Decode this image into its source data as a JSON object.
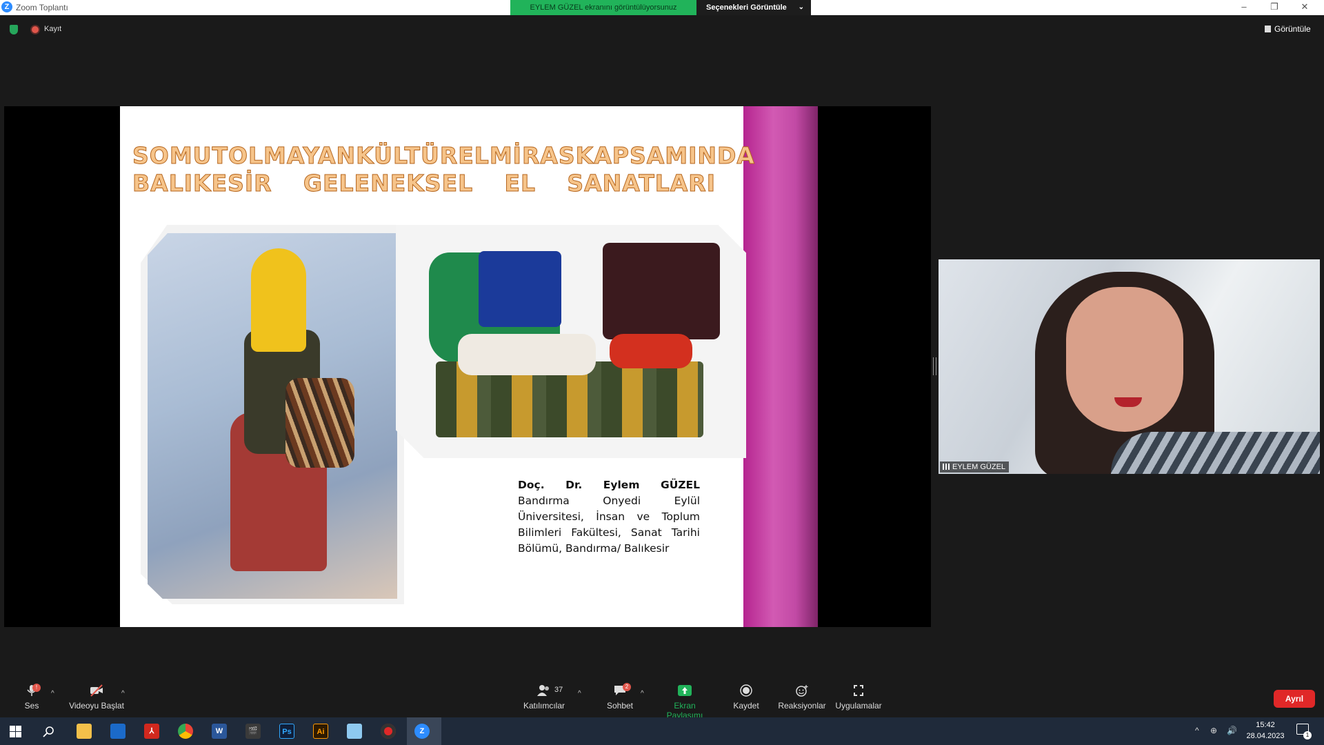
{
  "titlebar": {
    "app_title": "Zoom Toplantı",
    "share_banner": "EYLEM GÜZEL ekranını görüntülüyorsunuz",
    "view_options": "Seçenekleri Görüntüle",
    "minimize": "–",
    "restore": "❐",
    "close": "✕"
  },
  "topbar": {
    "record_label": "Kayıt",
    "view_label": "Görüntüle"
  },
  "slide": {
    "title_row1": [
      "SOMUT",
      "OLMAYAN",
      "KÜLTÜREL",
      "MİRAS",
      "KAPSAMINDA"
    ],
    "title_row2": [
      "BALIKESİR",
      "GELENEKSEL",
      "EL",
      "SANATLARI"
    ],
    "author_name_parts": [
      "Doç.",
      "Dr.",
      "Eylem",
      "GÜZEL"
    ],
    "author_affiliation": "Bandırma Onyedi Eylül Üniversitesi, İnsan ve Toplum Bilimleri Fakültesi, Sanat Tarihi Bölümü, Bandırma/ Balıkesir"
  },
  "participant": {
    "name": "EYLEM GÜZEL"
  },
  "controls": {
    "audio": "Ses",
    "audio_badge": "!",
    "video": "Videoyu Başlat",
    "participants": "Katılımcılar",
    "participants_count": "37",
    "chat": "Sohbet",
    "chat_badge": "2",
    "share_screen": "Ekran Paylaşımı",
    "record": "Kaydet",
    "reactions": "Reaksiyonlar",
    "apps": "Uygulamalar",
    "leave": "Ayrıl"
  },
  "taskbar": {
    "apps": [
      "Dosya Gezgini",
      "Ekran",
      "Acrobat",
      "Chrome",
      "Word",
      "Film",
      "Ps",
      "Ai",
      "Kalem",
      "Kayıt",
      "Zoom"
    ],
    "ps_label": "Ps",
    "ai_label": "Ai",
    "word_label": "W",
    "zoom_label": "Z",
    "time": "15:42",
    "date": "28.04.2023",
    "notif_count": "1"
  },
  "colors": {
    "share_green": "#21b35a",
    "leave_red": "#e02828",
    "zoom_blue": "#2d8cff",
    "slide_accent": "#c24aa5"
  }
}
